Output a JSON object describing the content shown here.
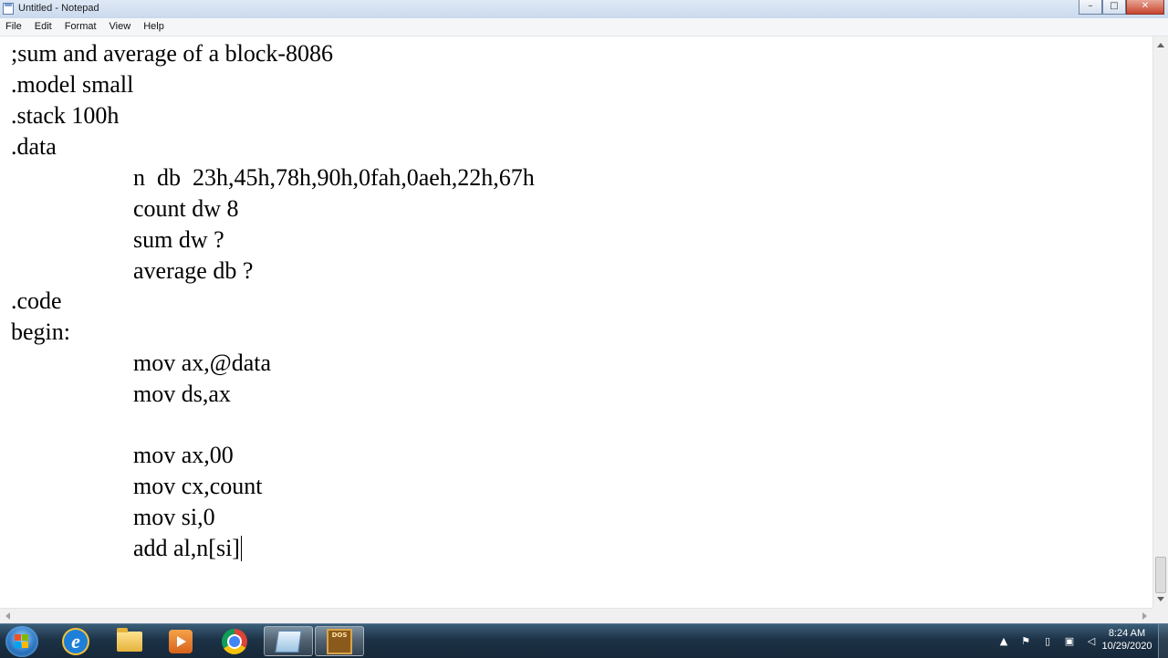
{
  "window": {
    "title": "Untitled - Notepad",
    "minimize_icon": "minimize-icon",
    "maximize_icon": "maximize-icon",
    "close_icon": "close-icon"
  },
  "menu": {
    "items": [
      "File",
      "Edit",
      "Format",
      "View",
      "Help"
    ]
  },
  "editor": {
    "lines": [
      ";sum and average of a block-8086",
      ".model small",
      ".stack 100h",
      ".data",
      "n  db  23h,45h,78h,90h,0fah,0aeh,22h,67h",
      "count dw 8",
      "sum dw ?",
      "average db ?",
      ".code",
      "begin:",
      "mov ax,@data",
      "mov ds,ax",
      "",
      "mov ax,00",
      "mov cx,count",
      "mov si,0",
      "add al,n[si]"
    ]
  },
  "taskbar": {
    "apps": [
      "internet-explorer-icon",
      "file-explorer-icon",
      "media-player-icon",
      "chrome-icon",
      "notepad-icon",
      "dosbox-icon"
    ],
    "dosbox_glyph": "DOS",
    "clock": {
      "time": "8:24 AM",
      "date": "10/29/2020"
    }
  }
}
